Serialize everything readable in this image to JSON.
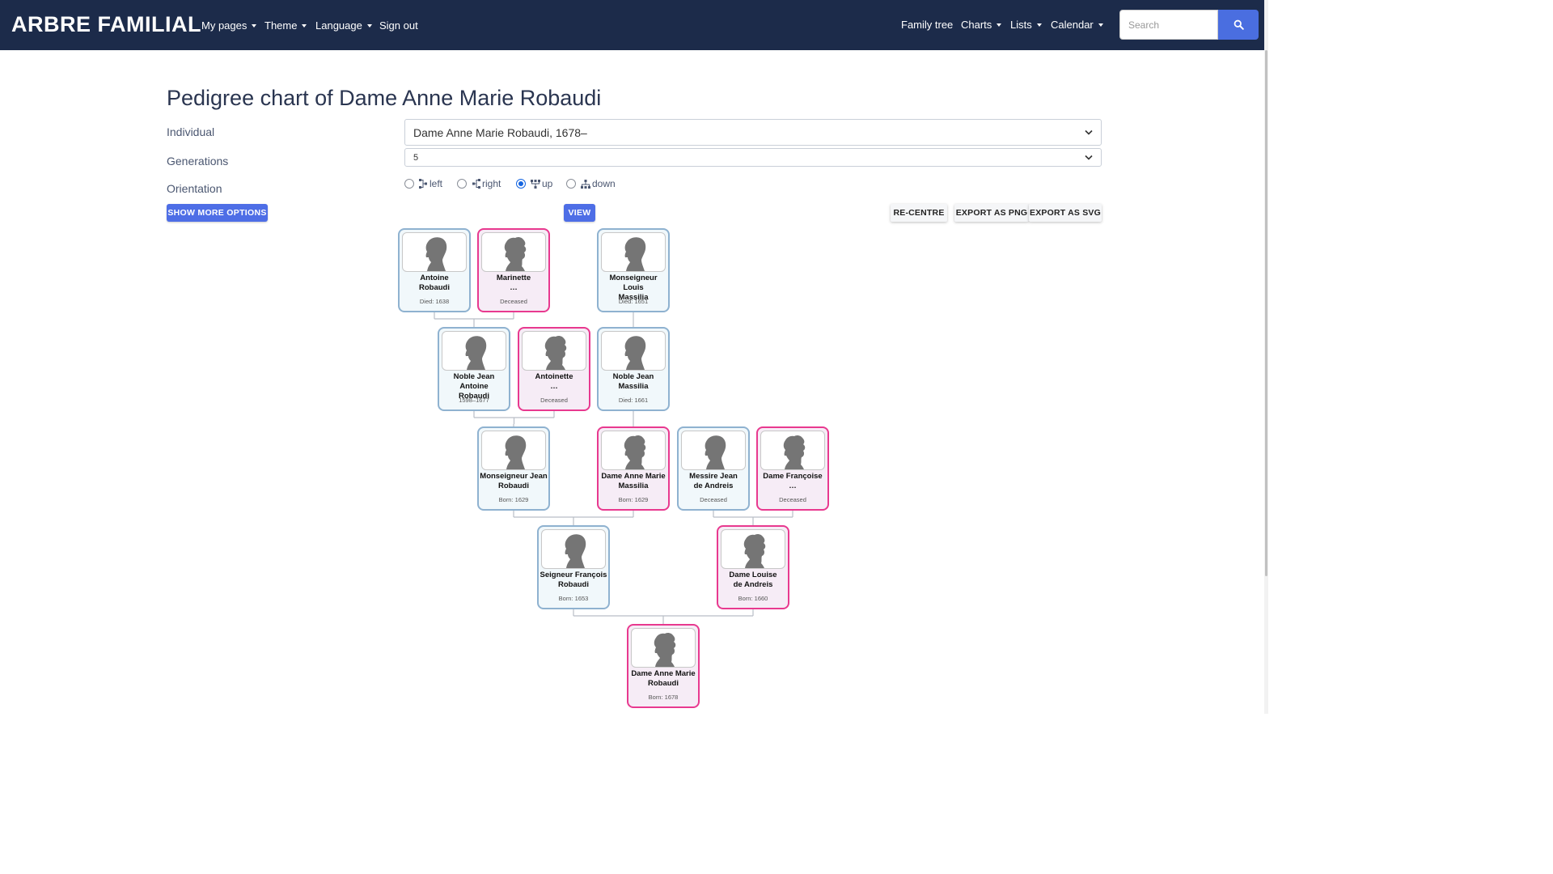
{
  "nav": {
    "brand": "ARBRE FAMILIAL",
    "left_menu": [
      "My pages",
      "Theme",
      "Language",
      "Sign out"
    ],
    "right_menu": [
      "Family tree",
      "Charts",
      "Lists",
      "Calendar"
    ],
    "search_placeholder": "Search"
  },
  "page": {
    "title": "Pedigree chart of Dame Anne Marie Robaudi"
  },
  "form": {
    "individual_label": "Individual",
    "individual_value": "Dame Anne Marie Robaudi, 1678–",
    "generations_label": "Generations",
    "generations_value": "5",
    "orientation_label": "Orientation",
    "orientation_options": [
      "left",
      "right",
      "up",
      "down"
    ],
    "orientation_selected": "up",
    "show_more_label": "SHOW MORE OPTIONS",
    "view_label": "VIEW",
    "recentre_label": "RE-CENTRE",
    "export_png_label": "EXPORT AS PNG",
    "export_svg_label": "EXPORT AS SVG"
  },
  "tree": {
    "people": [
      {
        "key": "antoine",
        "name": [
          "Antoine",
          "Robaudi"
        ],
        "date": "Died: 1638",
        "sex": "M"
      },
      {
        "key": "marinette",
        "name": [
          "Marinette",
          "…"
        ],
        "date": "Deceased",
        "sex": "F"
      },
      {
        "key": "louis",
        "name": [
          "Monseigneur Louis",
          "Massilia"
        ],
        "date": "Died: 1651",
        "sex": "M"
      },
      {
        "key": "jean_antoine",
        "name": [
          "Noble Jean Antoine",
          "Robaudi"
        ],
        "date": "1598–1677",
        "sex": "M"
      },
      {
        "key": "antoinette",
        "name": [
          "Antoinette",
          "…"
        ],
        "date": "Deceased",
        "sex": "F"
      },
      {
        "key": "jean_massilia",
        "name": [
          "Noble Jean",
          "Massilia"
        ],
        "date": "Died: 1661",
        "sex": "M"
      },
      {
        "key": "jean_robaudi",
        "name": [
          "Monseigneur Jean",
          "Robaudi"
        ],
        "date": "Born: 1629",
        "sex": "M"
      },
      {
        "key": "anne_massilia",
        "name": [
          "Dame Anne Marie",
          "Massilia"
        ],
        "date": "Born: 1629",
        "sex": "F"
      },
      {
        "key": "jean_andreis",
        "name": [
          "Messire Jean",
          "de Andreis"
        ],
        "date": "Deceased",
        "sex": "M"
      },
      {
        "key": "francoise",
        "name": [
          "Dame Françoise",
          "…"
        ],
        "date": "Deceased",
        "sex": "F"
      },
      {
        "key": "francois",
        "name": [
          "Seigneur François",
          "Robaudi"
        ],
        "date": "Born: 1653",
        "sex": "M"
      },
      {
        "key": "louise",
        "name": [
          "Dame Louise",
          "de Andreis"
        ],
        "date": "Born: 1660",
        "sex": "F"
      },
      {
        "key": "anne_robaudi",
        "name": [
          "Dame Anne Marie",
          "Robaudi"
        ],
        "date": "Born: 1678",
        "sex": "F"
      }
    ],
    "families": [
      {
        "father": "antoine",
        "mother": "marinette",
        "child": "jean_antoine"
      },
      {
        "father": "louis",
        "child": "jean_massilia"
      },
      {
        "father": "jean_antoine",
        "mother": "antoinette",
        "child": "jean_robaudi"
      },
      {
        "father": "jean_massilia",
        "child": "anne_massilia"
      },
      {
        "father": "jean_robaudi",
        "mother": "anne_massilia",
        "child": "francois"
      },
      {
        "father": "jean_andreis",
        "mother": "francoise",
        "child": "louise"
      },
      {
        "father": "francois",
        "mother": "louise",
        "child": "anne_robaudi"
      }
    ]
  },
  "colors": {
    "navbar": "#1c2b4a",
    "accent": "#4e6ee6",
    "male_border": "#8fb2d0",
    "female_border": "#e8398f",
    "male_bg": "#f1f8fb",
    "female_bg": "#f6ecf6"
  }
}
